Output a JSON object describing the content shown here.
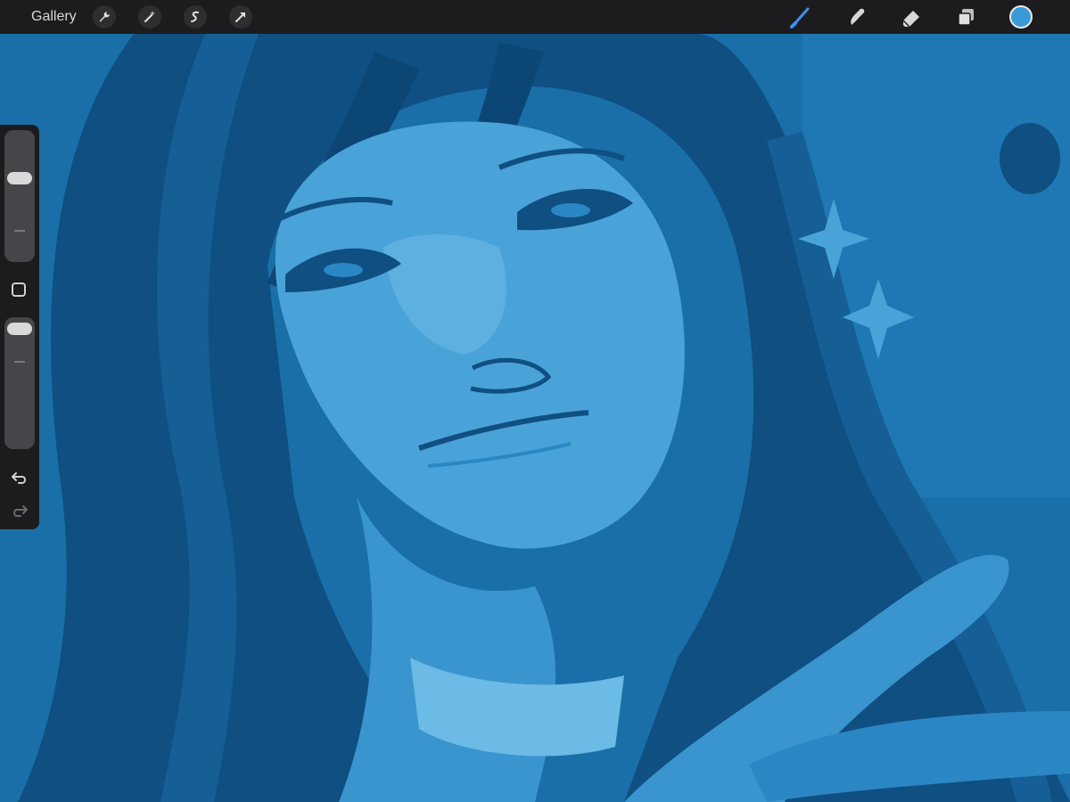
{
  "toolbar": {
    "gallery_label": "Gallery",
    "left_tools": [
      "wrench-icon",
      "magic-wand-icon",
      "selection-icon",
      "transform-arrow-icon"
    ],
    "right_tools": [
      "brush-icon",
      "smudge-icon",
      "eraser-icon",
      "layers-icon"
    ],
    "active_tool": "brush-icon",
    "active_color": "#3a9ad9",
    "accent": "#3d8ff5"
  },
  "sidebar": {
    "brush_size_level": 0.65,
    "opacity_level": 0.92,
    "buttons": [
      "modify-square-icon",
      "undo-icon",
      "redo-icon"
    ]
  },
  "canvas": {
    "palette": [
      "#0f4f82",
      "#1a6fa8",
      "#2b86c4",
      "#4aa3d8",
      "#6cbbe6"
    ]
  }
}
